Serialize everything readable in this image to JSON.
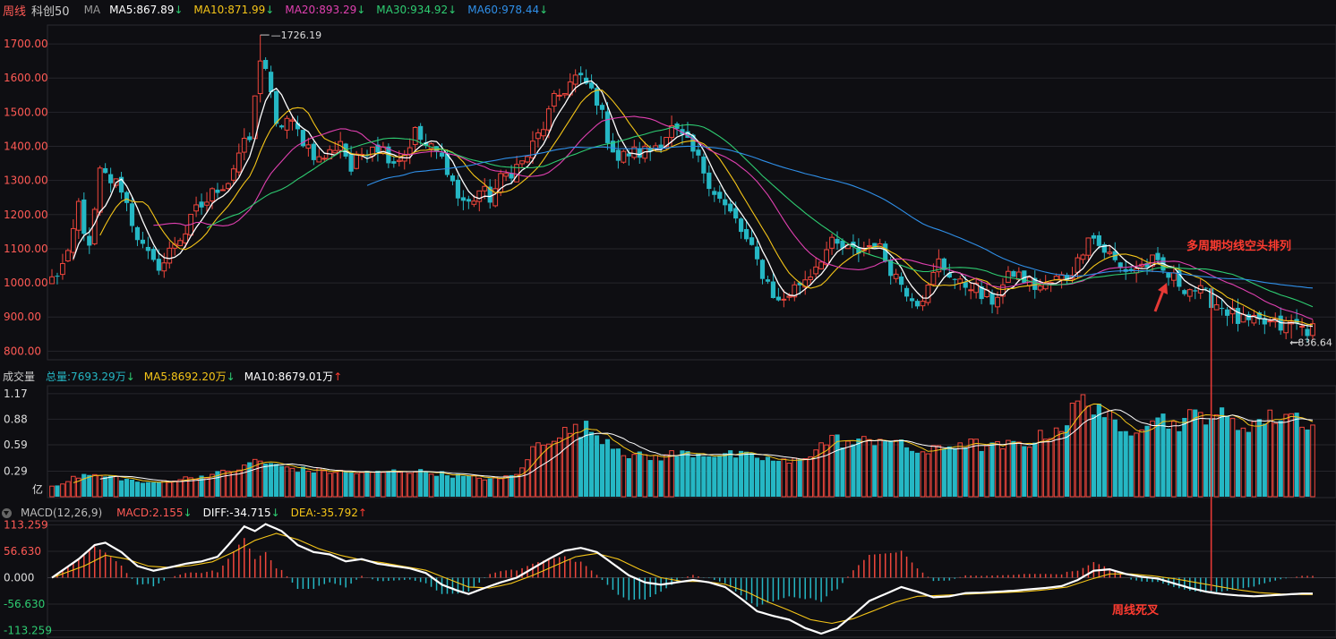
{
  "header": {
    "period": "周线",
    "symbol": "科创50",
    "ma_label": "MA",
    "ma": [
      {
        "label": "MA5:867.89",
        "arrow": "↓",
        "color": "#ffffff"
      },
      {
        "label": "MA10:871.99",
        "arrow": "↓",
        "color": "#f5c518"
      },
      {
        "label": "MA20:893.29",
        "arrow": "↓",
        "color": "#e040b0"
      },
      {
        "label": "MA30:934.92",
        "arrow": "↓",
        "color": "#2ecc71"
      },
      {
        "label": "MA60:978.44",
        "arrow": "↓",
        "color": "#2f8fe8"
      }
    ]
  },
  "volume_header": {
    "title": "成交量",
    "items": [
      {
        "label": "总量:7693.29万",
        "arrow": "↓",
        "color": "#25b7c4"
      },
      {
        "label": "MA5:8692.20万",
        "arrow": "↓",
        "color": "#f5c518"
      },
      {
        "label": "MA10:8679.01万",
        "arrow": "↑",
        "color": "#ffffff"
      }
    ]
  },
  "macd_header": {
    "title": "MACD(12,26,9)",
    "items": [
      {
        "label": "MACD:2.155",
        "arrow": "↓",
        "color": "#ff5a55"
      },
      {
        "label": "DIFF:-34.715",
        "arrow": "↓",
        "color": "#ffffff"
      },
      {
        "label": "DEA:-35.792",
        "arrow": "↑",
        "color": "#f5c518"
      }
    ]
  },
  "annotations": {
    "bearish_ma": "多周期均线空头排列",
    "death_cross": "周线死叉",
    "high_label": "1726.19",
    "low_label": "836.64"
  },
  "colors": {
    "up": "#f0463c",
    "down": "#25b7c4",
    "grid": "#2a2a30",
    "axis_text": "#ff5a55"
  },
  "chart_data": [
    {
      "type": "candlestick",
      "ylim": [
        780,
        1750
      ],
      "y_ticks": [
        "1700.00",
        "1600.00",
        "1500.00",
        "1400.00",
        "1300.00",
        "1200.00",
        "1100.00",
        "1000.00",
        "900.00",
        "800.00"
      ],
      "y_tick_values": [
        1700,
        1600,
        1500,
        1400,
        1300,
        1200,
        1100,
        1000,
        900,
        800
      ],
      "max_close": 1726.19,
      "min_close": 836.64,
      "ma_last": {
        "MA5": 867.89,
        "MA10": 871.99,
        "MA20": 893.29,
        "MA30": 934.92,
        "MA60": 978.44
      },
      "anchors": [
        [
          0,
          1010
        ],
        [
          3,
          1070
        ],
        [
          5,
          1230
        ],
        [
          7,
          1090
        ],
        [
          9,
          1320
        ],
        [
          11,
          1300
        ],
        [
          13,
          1280
        ],
        [
          15,
          1180
        ],
        [
          17,
          1100
        ],
        [
          19,
          1050
        ],
        [
          21,
          1060
        ],
        [
          23,
          1120
        ],
        [
          25,
          1150
        ],
        [
          27,
          1210
        ],
        [
          29,
          1240
        ],
        [
          31,
          1280
        ],
        [
          33,
          1300
        ],
        [
          35,
          1380
        ],
        [
          37,
          1420
        ],
        [
          39,
          1650
        ],
        [
          40,
          1630
        ],
        [
          42,
          1450
        ],
        [
          44,
          1480
        ],
        [
          46,
          1440
        ],
        [
          48,
          1400
        ],
        [
          50,
          1360
        ],
        [
          52,
          1380
        ],
        [
          54,
          1420
        ],
        [
          56,
          1330
        ],
        [
          58,
          1380
        ],
        [
          60,
          1410
        ],
        [
          62,
          1390
        ],
        [
          64,
          1360
        ],
        [
          66,
          1380
        ],
        [
          68,
          1440
        ],
        [
          70,
          1400
        ],
        [
          72,
          1380
        ],
        [
          74,
          1340
        ],
        [
          76,
          1250
        ],
        [
          78,
          1230
        ],
        [
          80,
          1270
        ],
        [
          82,
          1250
        ],
        [
          84,
          1300
        ],
        [
          86,
          1330
        ],
        [
          88,
          1350
        ],
        [
          90,
          1400
        ],
        [
          92,
          1460
        ],
        [
          94,
          1530
        ],
        [
          96,
          1570
        ],
        [
          98,
          1600
        ],
        [
          100,
          1580
        ],
        [
          102,
          1540
        ],
        [
          104,
          1430
        ],
        [
          106,
          1360
        ],
        [
          108,
          1380
        ],
        [
          110,
          1380
        ],
        [
          112,
          1390
        ],
        [
          114,
          1420
        ],
        [
          116,
          1450
        ],
        [
          118,
          1420
        ],
        [
          120,
          1380
        ],
        [
          122,
          1330
        ],
        [
          124,
          1270
        ],
        [
          126,
          1220
        ],
        [
          128,
          1180
        ],
        [
          130,
          1120
        ],
        [
          132,
          1060
        ],
        [
          134,
          1000
        ],
        [
          136,
          940
        ],
        [
          138,
          970
        ],
        [
          140,
          1000
        ],
        [
          142,
          1030
        ],
        [
          144,
          1080
        ],
        [
          146,
          1110
        ],
        [
          148,
          1100
        ],
        [
          150,
          1090
        ],
        [
          152,
          1100
        ],
        [
          154,
          1120
        ],
        [
          156,
          1070
        ],
        [
          158,
          1020
        ],
        [
          160,
          980
        ],
        [
          162,
          950
        ],
        [
          164,
          980
        ],
        [
          166,
          1060
        ],
        [
          168,
          1030
        ],
        [
          170,
          990
        ],
        [
          172,
          1000
        ],
        [
          174,
          960
        ],
        [
          176,
          950
        ],
        [
          178,
          990
        ],
        [
          180,
          1030
        ],
        [
          182,
          1010
        ],
        [
          184,
          990
        ],
        [
          186,
          990
        ],
        [
          188,
          1010
        ],
        [
          190,
          1020
        ],
        [
          192,
          1060
        ],
        [
          194,
          1150
        ],
        [
          196,
          1110
        ],
        [
          198,
          1080
        ],
        [
          200,
          1040
        ],
        [
          202,
          1040
        ],
        [
          204,
          1050
        ],
        [
          206,
          1060
        ],
        [
          208,
          1030
        ],
        [
          210,
          1010
        ],
        [
          212,
          990
        ],
        [
          214,
          980
        ],
        [
          216,
          960
        ],
        [
          218,
          940
        ],
        [
          220,
          920
        ],
        [
          222,
          890
        ],
        [
          224,
          880
        ],
        [
          226,
          880
        ],
        [
          228,
          880
        ],
        [
          230,
          870
        ],
        [
          232,
          880
        ],
        [
          234,
          870
        ],
        [
          236,
          860
        ]
      ],
      "high_index": 39,
      "low_index": 232,
      "cross_index": 217
    },
    {
      "type": "bar",
      "title": "成交量",
      "unit": "亿",
      "ylim": [
        0,
        1.25
      ],
      "y_ticks": [
        "1.17",
        "0.88",
        "0.59",
        "0.29"
      ],
      "y_tick_values": [
        1.17,
        0.88,
        0.59,
        0.29
      ],
      "anchors": [
        [
          0,
          0.12
        ],
        [
          6,
          0.25
        ],
        [
          12,
          0.22
        ],
        [
          18,
          0.15
        ],
        [
          24,
          0.2
        ],
        [
          30,
          0.25
        ],
        [
          36,
          0.33
        ],
        [
          38,
          0.42
        ],
        [
          42,
          0.35
        ],
        [
          48,
          0.3
        ],
        [
          54,
          0.28
        ],
        [
          60,
          0.27
        ],
        [
          66,
          0.3
        ],
        [
          72,
          0.27
        ],
        [
          78,
          0.22
        ],
        [
          84,
          0.2
        ],
        [
          88,
          0.3
        ],
        [
          90,
          0.55
        ],
        [
          94,
          0.7
        ],
        [
          100,
          0.78
        ],
        [
          104,
          0.65
        ],
        [
          108,
          0.48
        ],
        [
          112,
          0.44
        ],
        [
          116,
          0.48
        ],
        [
          120,
          0.5
        ],
        [
          126,
          0.48
        ],
        [
          132,
          0.45
        ],
        [
          138,
          0.38
        ],
        [
          142,
          0.5
        ],
        [
          146,
          0.66
        ],
        [
          150,
          0.6
        ],
        [
          156,
          0.68
        ],
        [
          160,
          0.55
        ],
        [
          164,
          0.5
        ],
        [
          170,
          0.62
        ],
        [
          176,
          0.56
        ],
        [
          182,
          0.6
        ],
        [
          186,
          0.7
        ],
        [
          190,
          0.85
        ],
        [
          192,
          1.08
        ],
        [
          196,
          1.05
        ],
        [
          200,
          0.7
        ],
        [
          204,
          0.85
        ],
        [
          206,
          0.95
        ],
        [
          210,
          0.82
        ],
        [
          214,
          0.92
        ],
        [
          218,
          0.95
        ],
        [
          222,
          0.8
        ],
        [
          226,
          0.86
        ],
        [
          230,
          0.92
        ],
        [
          232,
          0.95
        ],
        [
          236,
          0.8
        ]
      ]
    },
    {
      "type": "bar",
      "title": "MACD(12,26,9)",
      "ylim": [
        -120,
        120
      ],
      "y_ticks": [
        "113.259",
        "56.630",
        "0.000",
        "-56.630",
        "-113.259"
      ],
      "y_tick_values": [
        113.259,
        56.63,
        0,
        -56.63,
        -113.259
      ],
      "diff_anchors": [
        [
          0,
          0
        ],
        [
          5,
          40
        ],
        [
          8,
          70
        ],
        [
          10,
          75
        ],
        [
          13,
          55
        ],
        [
          16,
          25
        ],
        [
          19,
          15
        ],
        [
          22,
          22
        ],
        [
          25,
          30
        ],
        [
          28,
          35
        ],
        [
          31,
          45
        ],
        [
          33,
          70
        ],
        [
          36,
          110
        ],
        [
          38,
          100
        ],
        [
          40,
          115
        ],
        [
          43,
          100
        ],
        [
          46,
          70
        ],
        [
          49,
          55
        ],
        [
          52,
          50
        ],
        [
          55,
          35
        ],
        [
          58,
          40
        ],
        [
          61,
          30
        ],
        [
          64,
          25
        ],
        [
          67,
          20
        ],
        [
          70,
          10
        ],
        [
          73,
          -15
        ],
        [
          76,
          -28
        ],
        [
          78,
          -35
        ],
        [
          81,
          -22
        ],
        [
          84,
          -10
        ],
        [
          87,
          0
        ],
        [
          90,
          20
        ],
        [
          93,
          40
        ],
        [
          96,
          58
        ],
        [
          99,
          64
        ],
        [
          102,
          55
        ],
        [
          105,
          30
        ],
        [
          108,
          5
        ],
        [
          111,
          -10
        ],
        [
          114,
          -15
        ],
        [
          117,
          -10
        ],
        [
          120,
          -5
        ],
        [
          123,
          -10
        ],
        [
          126,
          -20
        ],
        [
          129,
          -45
        ],
        [
          132,
          -72
        ],
        [
          135,
          -82
        ],
        [
          138,
          -90
        ],
        [
          141,
          -108
        ],
        [
          144,
          -120
        ],
        [
          147,
          -108
        ],
        [
          150,
          -80
        ],
        [
          153,
          -50
        ],
        [
          156,
          -35
        ],
        [
          159,
          -20
        ],
        [
          162,
          -30
        ],
        [
          165,
          -42
        ],
        [
          168,
          -40
        ],
        [
          171,
          -33
        ],
        [
          174,
          -32
        ],
        [
          177,
          -30
        ],
        [
          180,
          -28
        ],
        [
          183,
          -25
        ],
        [
          186,
          -22
        ],
        [
          189,
          -18
        ],
        [
          192,
          -5
        ],
        [
          195,
          15
        ],
        [
          198,
          18
        ],
        [
          201,
          8
        ],
        [
          204,
          2
        ],
        [
          207,
          -2
        ],
        [
          210,
          -12
        ],
        [
          213,
          -22
        ],
        [
          216,
          -30
        ],
        [
          219,
          -35
        ],
        [
          222,
          -38
        ],
        [
          225,
          -40
        ],
        [
          228,
          -38
        ],
        [
          231,
          -36
        ],
        [
          234,
          -34
        ],
        [
          236,
          -34
        ]
      ],
      "dea_anchors": [
        [
          0,
          0
        ],
        [
          6,
          25
        ],
        [
          10,
          48
        ],
        [
          14,
          40
        ],
        [
          18,
          25
        ],
        [
          22,
          22
        ],
        [
          26,
          26
        ],
        [
          30,
          34
        ],
        [
          34,
          55
        ],
        [
          38,
          80
        ],
        [
          42,
          95
        ],
        [
          46,
          82
        ],
        [
          50,
          62
        ],
        [
          54,
          48
        ],
        [
          58,
          38
        ],
        [
          62,
          32
        ],
        [
          66,
          24
        ],
        [
          70,
          16
        ],
        [
          74,
          -2
        ],
        [
          78,
          -20
        ],
        [
          82,
          -22
        ],
        [
          86,
          -12
        ],
        [
          90,
          5
        ],
        [
          94,
          25
        ],
        [
          98,
          45
        ],
        [
          102,
          52
        ],
        [
          106,
          40
        ],
        [
          110,
          18
        ],
        [
          114,
          0
        ],
        [
          118,
          -8
        ],
        [
          122,
          -8
        ],
        [
          126,
          -14
        ],
        [
          130,
          -30
        ],
        [
          134,
          -52
        ],
        [
          138,
          -70
        ],
        [
          142,
          -90
        ],
        [
          146,
          -98
        ],
        [
          150,
          -88
        ],
        [
          154,
          -70
        ],
        [
          158,
          -52
        ],
        [
          162,
          -40
        ],
        [
          166,
          -38
        ],
        [
          170,
          -36
        ],
        [
          174,
          -34
        ],
        [
          178,
          -32
        ],
        [
          182,
          -30
        ],
        [
          186,
          -26
        ],
        [
          190,
          -20
        ],
        [
          194,
          -5
        ],
        [
          198,
          8
        ],
        [
          202,
          8
        ],
        [
          206,
          4
        ],
        [
          210,
          -2
        ],
        [
          214,
          -10
        ],
        [
          218,
          -18
        ],
        [
          222,
          -26
        ],
        [
          226,
          -32
        ],
        [
          230,
          -35
        ],
        [
          234,
          -36
        ],
        [
          236,
          -36
        ]
      ]
    }
  ]
}
